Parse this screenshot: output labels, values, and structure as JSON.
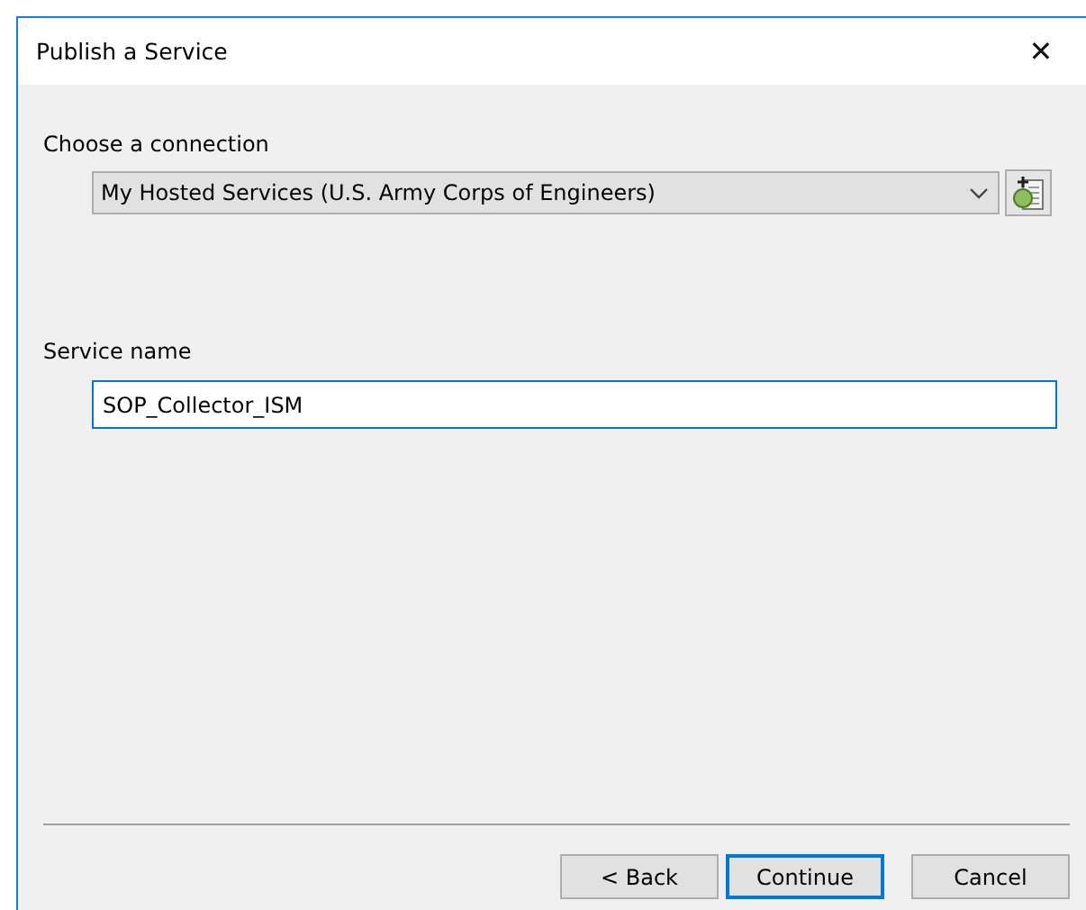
{
  "window": {
    "title": "Publish a Service",
    "close": "✕"
  },
  "connection": {
    "label": "Choose a connection",
    "value": "My Hosted Services (U.S. Army Corps of Engineers)"
  },
  "service_name": {
    "label": "Service name",
    "value": "SOP_Collector_ISM",
    "focused": true
  },
  "buttons": [
    {
      "label": "< Back",
      "default": false
    },
    {
      "label": "Continue",
      "default": true
    },
    {
      "label": "Cancel",
      "default": false
    }
  ]
}
